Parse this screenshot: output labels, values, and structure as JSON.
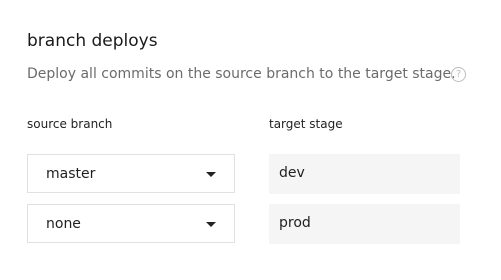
{
  "section": {
    "title": "branch deploys",
    "description": "Deploy all commits on the source branch to the target stage.",
    "help_icon": "?"
  },
  "columns": {
    "source_label": "source branch",
    "target_label": "target stage"
  },
  "rows": [
    {
      "source_branch": "master",
      "target_stage": "dev"
    },
    {
      "source_branch": "none",
      "target_stage": "prod"
    }
  ],
  "icons": {
    "help": "question-circle-icon",
    "dropdown": "caret-down-icon"
  },
  "colors": {
    "text": "#1f1f1f",
    "muted": "#6b6b6b",
    "border": "#e1e1e1",
    "stage_bg": "#f5f5f5"
  }
}
